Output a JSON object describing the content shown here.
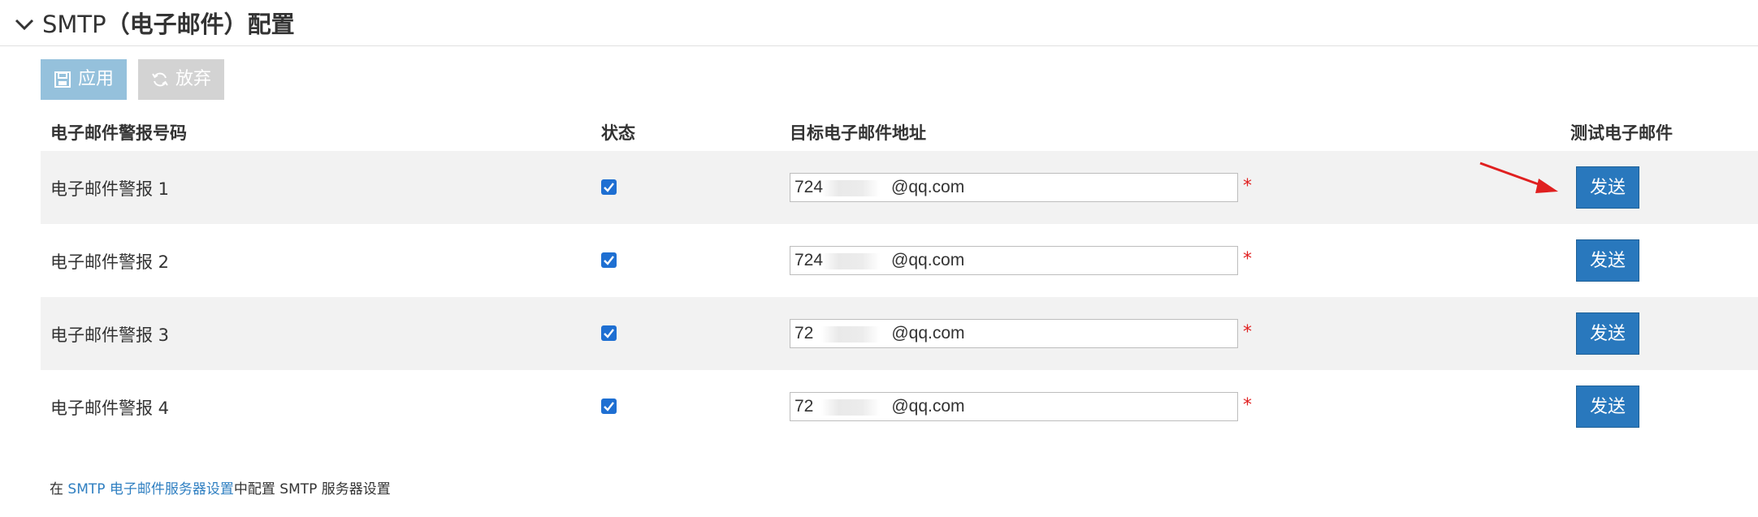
{
  "header": {
    "title_prefix": "SMTP",
    "title_suffix": "（电子邮件）配置"
  },
  "toolbar": {
    "apply_label": "应用",
    "discard_label": "放弃"
  },
  "table": {
    "columns": {
      "name": "电子邮件警报号码",
      "status": "状态",
      "target": "目标电子邮件地址",
      "test": "测试电子邮件"
    },
    "rows": [
      {
        "label": "电子邮件警报 1",
        "checked": true,
        "email_start": "724",
        "email_end": "@qq.com",
        "required": "*",
        "send_label": "发送"
      },
      {
        "label": "电子邮件警报 2",
        "checked": true,
        "email_start": "724",
        "email_end": "@qq.com",
        "required": "*",
        "send_label": "发送"
      },
      {
        "label": "电子邮件警报 3",
        "checked": true,
        "email_start": "72",
        "email_end": "@qq.com",
        "required": "*",
        "send_label": "发送"
      },
      {
        "label": "电子邮件警报 4",
        "checked": true,
        "email_start": "72",
        "email_end": "@qq.com",
        "required": "*",
        "send_label": "发送"
      }
    ]
  },
  "footer": {
    "prefix": "在 ",
    "link": "SMTP 电子邮件服务器设置",
    "suffix": "中配置 SMTP 服务器设置"
  },
  "colors": {
    "primary_button": "#2978bd",
    "apply_button_disabled": "#95c1dc",
    "discard_button_disabled": "#d3d3d3",
    "required_marker": "#e02020",
    "link": "#2f7fc1",
    "annotation_arrow": "#e02020"
  }
}
